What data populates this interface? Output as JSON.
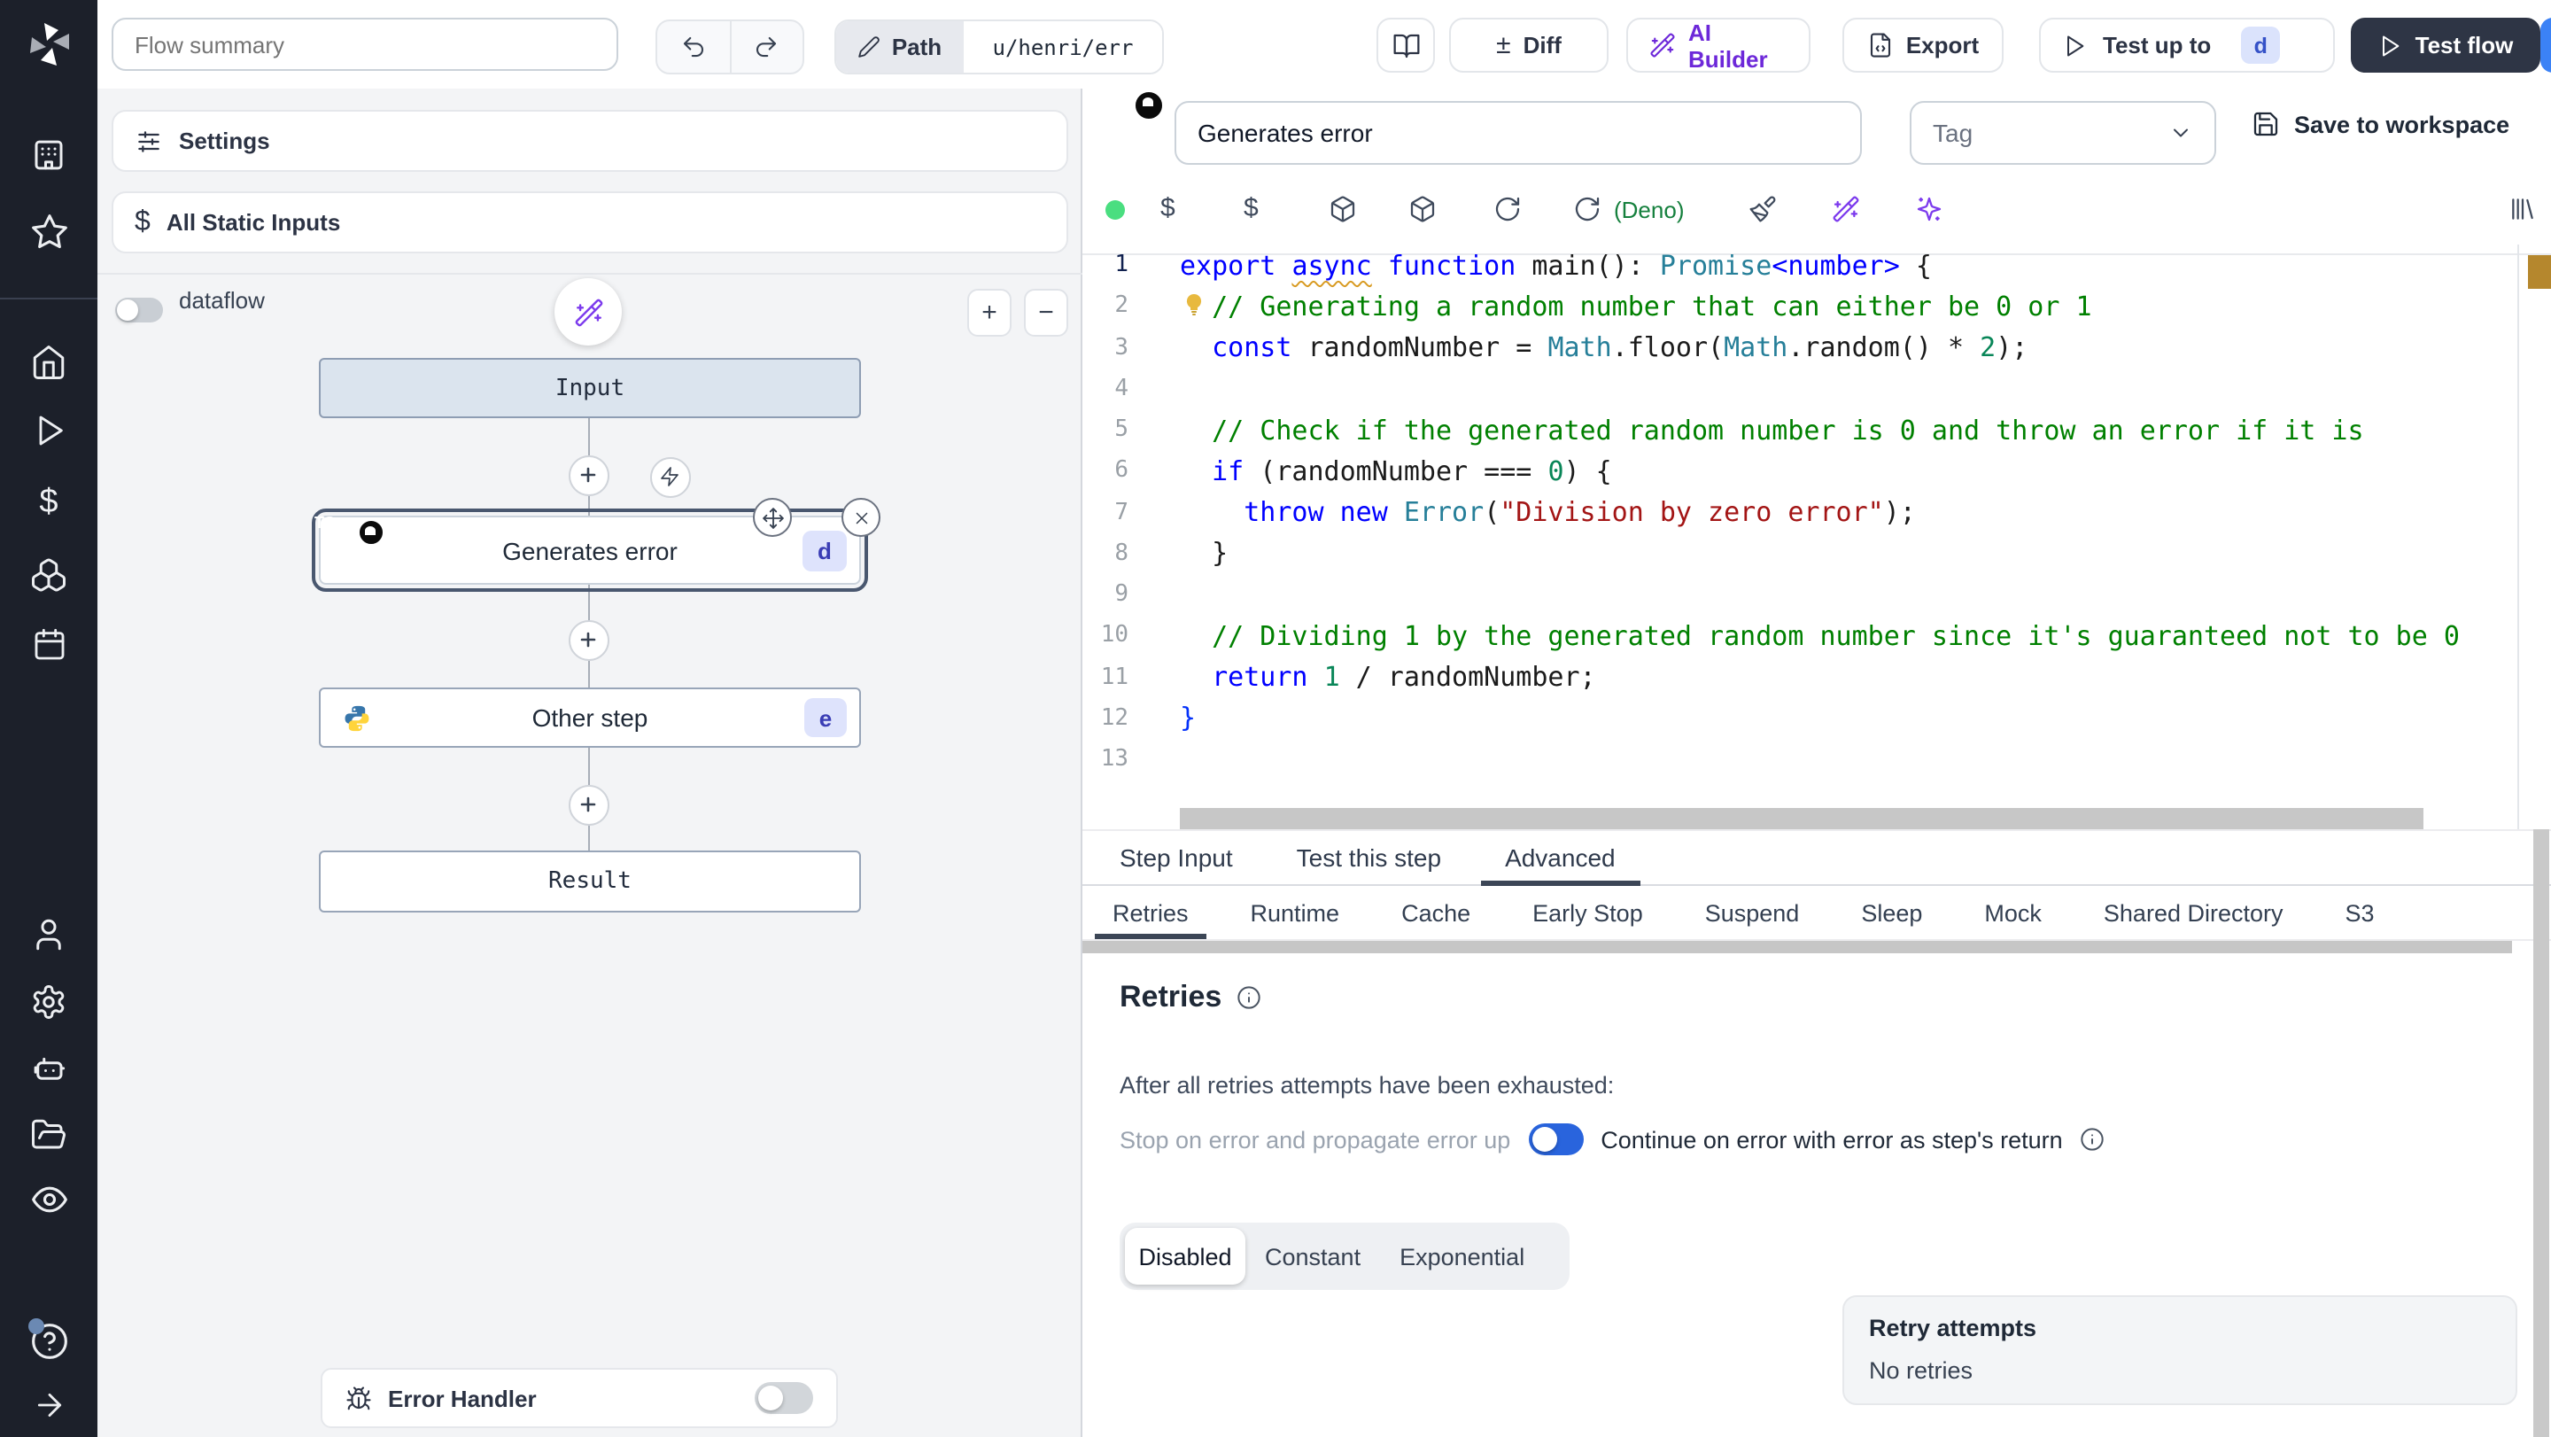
{
  "app": {
    "name": "Windmill flow editor"
  },
  "topbar": {
    "flow_summary_placeholder": "Flow summary",
    "path_label": "Path",
    "path_value": "u/henri/err",
    "diff_label": "Diff",
    "ai_builder_label": "AI Builder",
    "export_label": "Export",
    "test_up_to_label": "Test up to",
    "test_up_to_step": "d",
    "test_flow_label": "Test flow"
  },
  "flow_panel": {
    "settings_label": "Settings",
    "static_inputs_label": "All Static Inputs",
    "dataflow_label": "dataflow",
    "zoom_in_label": "+",
    "zoom_out_label": "−",
    "nodes": {
      "input_label": "Input",
      "step1": {
        "label": "Generates error",
        "badge": "d",
        "lang": "typescript-deno"
      },
      "step2": {
        "label": "Other step",
        "badge": "e",
        "lang": "python"
      },
      "result_label": "Result"
    },
    "error_handler_label": "Error Handler"
  },
  "step_editor": {
    "name_value": "Generates error",
    "tag_placeholder": "Tag",
    "save_label": "Save to workspace",
    "runtime_label": "(Deno)",
    "tabs": [
      "Step Input",
      "Test this step",
      "Advanced"
    ],
    "active_tab": "Advanced",
    "subtabs": [
      "Retries",
      "Runtime",
      "Cache",
      "Early Stop",
      "Suspend",
      "Sleep",
      "Mock",
      "Shared Directory",
      "S3"
    ],
    "active_subtab": "Retries",
    "code_lines": [
      {
        "tokens": [
          {
            "t": "export ",
            "c": "k"
          },
          {
            "t": "async",
            "c": "k sq"
          },
          {
            "t": " ",
            "c": "p"
          },
          {
            "t": "function ",
            "c": "k"
          },
          {
            "t": "main",
            "c": "p"
          },
          {
            "t": "(): ",
            "c": "p"
          },
          {
            "t": "Promise",
            "c": "ty"
          },
          {
            "t": "<number>",
            "c": "k"
          },
          {
            "t": " {",
            "c": "p"
          }
        ]
      },
      {
        "bulb": true,
        "tokens": [
          {
            "t": "  ",
            "c": "p"
          },
          {
            "t": "// Generating a random number that can either be 0 or 1",
            "c": "cm"
          }
        ]
      },
      {
        "tokens": [
          {
            "t": "  ",
            "c": "p"
          },
          {
            "t": "const",
            "c": "k"
          },
          {
            "t": " randomNumber = ",
            "c": "p"
          },
          {
            "t": "Math",
            "c": "ty"
          },
          {
            "t": ".floor(",
            "c": "p"
          },
          {
            "t": "Math",
            "c": "ty"
          },
          {
            "t": ".random() * ",
            "c": "p"
          },
          {
            "t": "2",
            "c": "num"
          },
          {
            "t": ");",
            "c": "p"
          }
        ]
      },
      {
        "tokens": []
      },
      {
        "tokens": [
          {
            "t": "  ",
            "c": "p"
          },
          {
            "t": "// Check if the generated random number is 0 and throw an error if it is",
            "c": "cm"
          }
        ]
      },
      {
        "tokens": [
          {
            "t": "  ",
            "c": "p"
          },
          {
            "t": "if",
            "c": "k"
          },
          {
            "t": " (randomNumber === ",
            "c": "p"
          },
          {
            "t": "0",
            "c": "num"
          },
          {
            "t": ") {",
            "c": "p"
          }
        ]
      },
      {
        "tokens": [
          {
            "t": "    ",
            "c": "p"
          },
          {
            "t": "throw",
            "c": "k"
          },
          {
            "t": " ",
            "c": "p"
          },
          {
            "t": "new",
            "c": "k"
          },
          {
            "t": " ",
            "c": "p"
          },
          {
            "t": "Error",
            "c": "ty"
          },
          {
            "t": "(",
            "c": "p"
          },
          {
            "t": "\"Division by zero error\"",
            "c": "str"
          },
          {
            "t": ");",
            "c": "p"
          }
        ]
      },
      {
        "tokens": [
          {
            "t": "  }",
            "c": "p"
          }
        ]
      },
      {
        "tokens": []
      },
      {
        "tokens": [
          {
            "t": "  ",
            "c": "p"
          },
          {
            "t": "// Dividing 1 by the generated random number since it's guaranteed not to be 0",
            "c": "cm"
          }
        ]
      },
      {
        "tokens": [
          {
            "t": "  ",
            "c": "p"
          },
          {
            "t": "return",
            "c": "k"
          },
          {
            "t": " ",
            "c": "p"
          },
          {
            "t": "1",
            "c": "num"
          },
          {
            "t": " / randomNumber;",
            "c": "p"
          }
        ]
      },
      {
        "tokens": [
          {
            "t": "}",
            "c": "br"
          }
        ]
      },
      {
        "tokens": []
      }
    ]
  },
  "retries": {
    "title": "Retries",
    "exhausted_text": "After all retries attempts have been exhausted:",
    "stop_option": "Stop on error and propagate error up",
    "continue_option": "Continue on error with error as step's return",
    "continue_enabled": true,
    "modes": [
      "Disabled",
      "Constant",
      "Exponential"
    ],
    "active_mode": "Disabled",
    "retry_attempts_label": "Retry attempts",
    "retry_attempts_value": "No retries"
  },
  "colors": {
    "sidebar_bg": "#1c202a",
    "accent_purple": "#7c3aed",
    "toggle_on_blue": "#2964dd",
    "deno_green": "#15803d",
    "status_dot_green": "#4ade80",
    "badge_bg": "#dee3fc",
    "badge_text": "#3a3db5",
    "dark_button_bg": "#2e3545",
    "ruler_warning": "#b5872d"
  },
  "icons": {
    "sidebar": [
      "windmill-logo",
      "building-icon",
      "star-icon",
      "home-icon",
      "play-icon",
      "dollar-icon",
      "boxes-icon",
      "calendar-icon",
      "user-icon",
      "gear-icon",
      "robot-icon",
      "folder-icon",
      "eye-icon",
      "help-icon",
      "arrow-right-icon"
    ],
    "toolbar": [
      "status-dot",
      "dollar-icon",
      "dollar-icon",
      "package-icon",
      "package-icon",
      "refresh-icon",
      "refresh-icon",
      "paintbrush-icon",
      "magic-wand-icon",
      "sparkles-icon",
      "library-icon"
    ]
  }
}
